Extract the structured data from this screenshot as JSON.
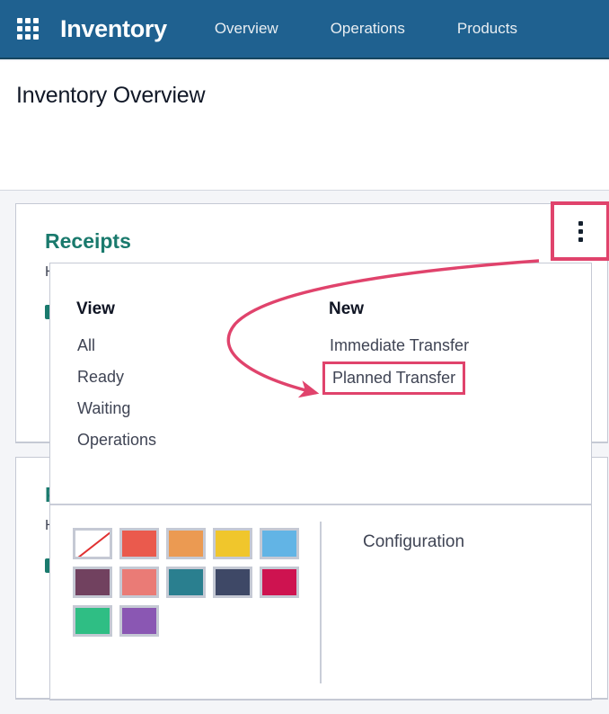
{
  "navbar": {
    "apps_icon": "apps-grid-icon",
    "brand": "Inventory",
    "links": [
      {
        "label": "Overview"
      },
      {
        "label": "Operations"
      },
      {
        "label": "Products"
      }
    ],
    "background_color": "#1f6190"
  },
  "control_panel": {
    "page_title": "Inventory Overview"
  },
  "cards": [
    {
      "title": "Receipts",
      "subtitle": "H",
      "button_label": "",
      "kebab_icon": "kebab-menu-icon",
      "accent_color": "#1a7a6d"
    },
    {
      "title": "P",
      "subtitle": "H",
      "button_label": "",
      "accent_color": "#1a7a6d"
    }
  ],
  "dropdown": {
    "view": {
      "heading": "View",
      "items": [
        {
          "label": "All"
        },
        {
          "label": "Ready"
        },
        {
          "label": "Waiting"
        },
        {
          "label": "Operations"
        }
      ]
    },
    "new": {
      "heading": "New",
      "items": [
        {
          "label": "Immediate Transfer",
          "highlighted": false
        },
        {
          "label": "Planned Transfer",
          "highlighted": true
        }
      ]
    },
    "colors": {
      "rows": [
        [
          {
            "name": "no-color",
            "hex": "#ffffff"
          },
          {
            "name": "red",
            "hex": "#ea5a4d"
          },
          {
            "name": "orange",
            "hex": "#eb9a52"
          },
          {
            "name": "yellow",
            "hex": "#f0c62c"
          },
          {
            "name": "light-blue",
            "hex": "#62b4e5"
          }
        ],
        [
          {
            "name": "plum",
            "hex": "#71415f"
          },
          {
            "name": "salmon",
            "hex": "#ea7b76"
          },
          {
            "name": "teal",
            "hex": "#2a7f8f"
          },
          {
            "name": "navy",
            "hex": "#3e4866"
          },
          {
            "name": "crimson",
            "hex": "#ce1350"
          }
        ],
        [
          {
            "name": "green",
            "hex": "#2fbe84"
          },
          {
            "name": "purple",
            "hex": "#8a57b3"
          }
        ]
      ]
    },
    "configuration_label": "Configuration"
  },
  "annotation": {
    "highlight_color": "#e0436c",
    "arrow_from": "kebab-menu-button",
    "arrow_to": "Planned Transfer"
  }
}
